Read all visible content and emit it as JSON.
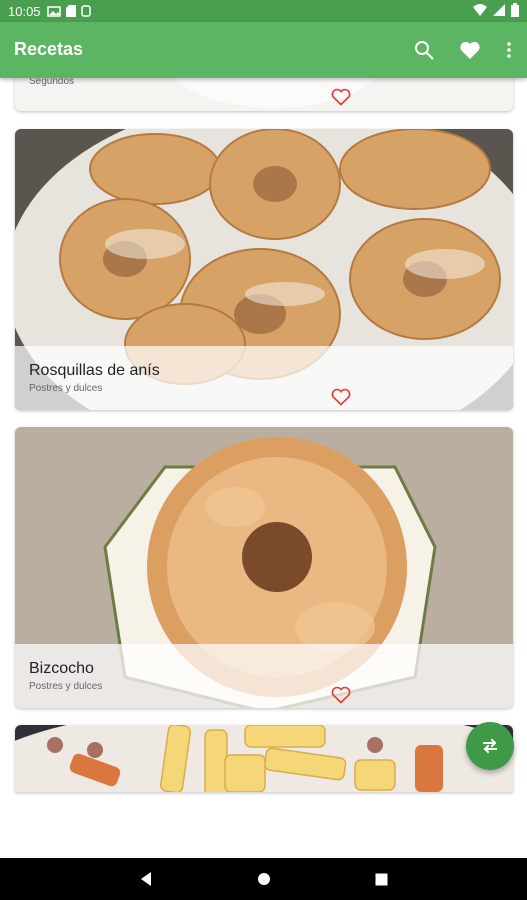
{
  "status_bar": {
    "time": "10:05",
    "icons_left": [
      "gallery-icon",
      "sd-card-icon",
      "storage-icon"
    ],
    "icons_right": [
      "wifi-icon",
      "signal-icon",
      "battery-icon"
    ]
  },
  "app_bar": {
    "title": "Recetas",
    "actions": [
      "search-icon",
      "favorites-heart-icon",
      "overflow-menu-icon"
    ]
  },
  "colors": {
    "app_bar": "#5cb563",
    "status_bar": "#4a9e50",
    "fab": "#3e9a46",
    "favorite": "#e53935"
  },
  "recipes": [
    {
      "title": "",
      "category": "Segundos",
      "favorite": false
    },
    {
      "title": "Rosquillas de anís",
      "category": "Postres y dulces",
      "favorite": false
    },
    {
      "title": "Bizcocho",
      "category": "Postres y dulces",
      "favorite": false
    },
    {
      "title": "",
      "category": "",
      "favorite": false
    }
  ],
  "fab": {
    "icon": "swap-icon"
  },
  "nav": [
    "back-icon",
    "home-icon",
    "recents-icon"
  ]
}
